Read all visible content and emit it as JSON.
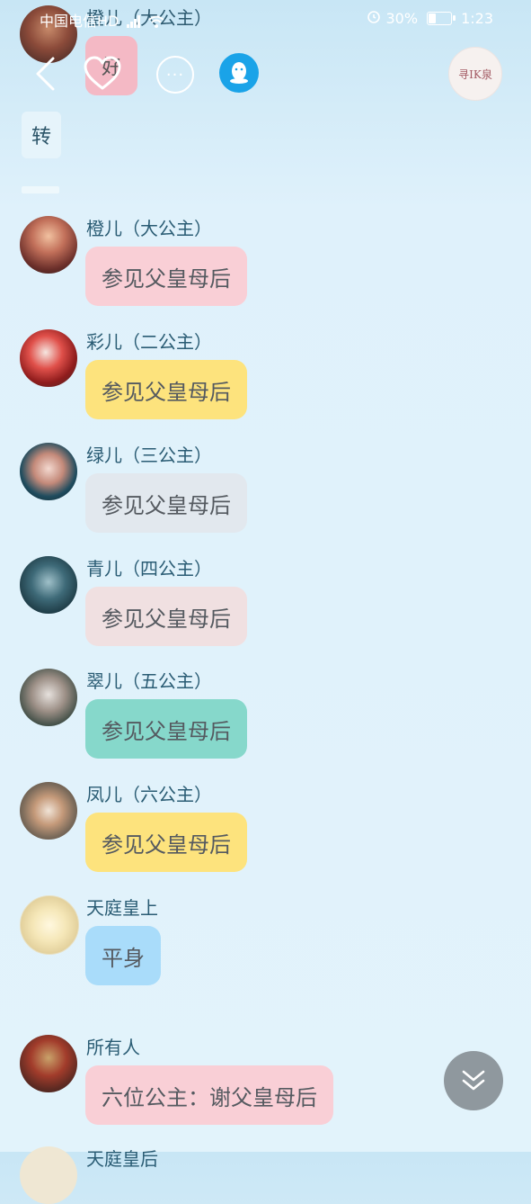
{
  "status_bar": {
    "carrier": "中国电信HD",
    "battery": "30%",
    "battery_level": 0.3,
    "time": "1:23"
  },
  "header": {
    "back_icon": "chevron-left-icon",
    "like_icon": "heart-icon",
    "more_icon": "ellipsis-icon",
    "qq_icon": "qq-penguin-icon",
    "group_avatar_text": "寻IK泉"
  },
  "top_preview": {
    "sender": "橙儿（大公主）",
    "bubble_text": "好",
    "transfer_label": "转"
  },
  "messages": [
    {
      "sender": "橙儿（大公主）",
      "text": "参见父皇母后",
      "bubble_color": "#f9cfd6"
    },
    {
      "sender": "彩儿（二公主）",
      "text": "参见父皇母后",
      "bubble_color": "#fde37d"
    },
    {
      "sender": "绿儿（三公主）",
      "text": "参见父皇母后",
      "bubble_color": "#e2e8ee"
    },
    {
      "sender": "青儿（四公主）",
      "text": "参见父皇母后",
      "bubble_color": "#f0e0e1"
    },
    {
      "sender": "翠儿（五公主）",
      "text": "参见父皇母后",
      "bubble_color": "#86d8cb"
    },
    {
      "sender": "凤儿（六公主）",
      "text": "参见父皇母后",
      "bubble_color": "#fde37d"
    },
    {
      "sender": "天庭皇上",
      "text": "平身",
      "bubble_color": "#a9dcfa"
    },
    {
      "sender": "所有人",
      "text": "六位公主：谢父皇母后",
      "bubble_color": "#f9cfd6"
    }
  ],
  "partial_sender": "天庭皇后",
  "scroll_down_icon": "double-chevron-down-icon"
}
